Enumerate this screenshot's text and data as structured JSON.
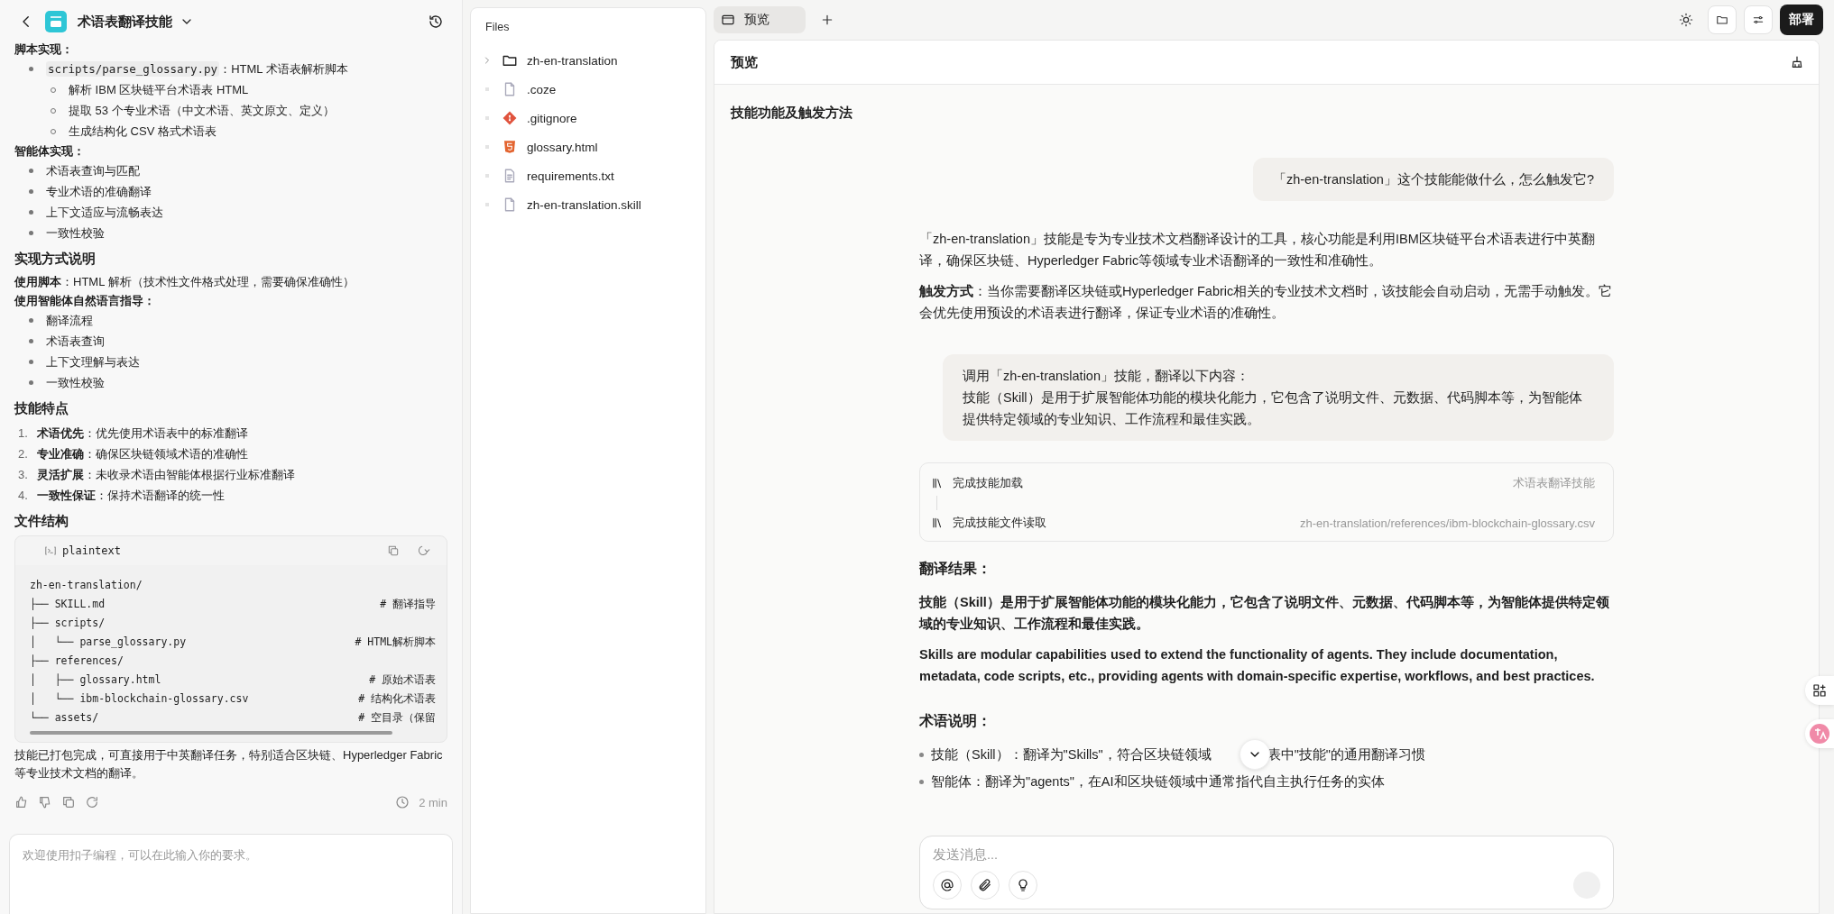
{
  "left": {
    "title": "术语表翻译技能",
    "blocks": [
      {
        "kind": "label",
        "text": "脚本实现："
      },
      {
        "kind": "bullets",
        "items": [
          {
            "code": "scripts/parse_glossary.py",
            "text": "：HTML 术语表解析脚本",
            "children": [
              {
                "text": "解析 IBM 区块链平台术语表 HTML"
              },
              {
                "text": "提取 53 个专业术语（中文术语、英文原文、定义）"
              },
              {
                "text": "生成结构化 CSV 格式术语表"
              }
            ]
          }
        ]
      },
      {
        "kind": "label",
        "text": "智能体实现："
      },
      {
        "kind": "bullets",
        "items": [
          {
            "text": "术语表查询与匹配"
          },
          {
            "text": "专业术语的准确翻译"
          },
          {
            "text": "上下文适应与流畅表达"
          },
          {
            "text": "一致性校验"
          }
        ]
      },
      {
        "kind": "heading",
        "text": "实现方式说明"
      },
      {
        "kind": "para",
        "text": "**使用脚本**：HTML 解析（技术性文件格式处理，需要确保准确性）"
      },
      {
        "kind": "label",
        "text": "使用智能体自然语言指导："
      },
      {
        "kind": "bullets",
        "items": [
          {
            "text": "翻译流程"
          },
          {
            "text": "术语表查询"
          },
          {
            "text": "上下文理解与表达"
          },
          {
            "text": "一致性校验"
          }
        ]
      },
      {
        "kind": "heading",
        "text": "技能特点"
      },
      {
        "kind": "numbered",
        "items": [
          {
            "num": "1.",
            "text": "**术语优先**：优先使用术语表中的标准翻译"
          },
          {
            "num": "2.",
            "text": "**专业准确**：确保区块链领域术语的准确性"
          },
          {
            "num": "3.",
            "text": "**灵活扩展**：未收录术语由智能体根据行业标准翻译"
          },
          {
            "num": "4.",
            "text": "**一致性保证**：保持术语翻译的统一性"
          }
        ]
      },
      {
        "kind": "heading",
        "text": "文件结构"
      },
      {
        "kind": "code",
        "lang": "plaintext",
        "lines": [
          {
            "path": "zh-en-translation/"
          },
          {
            "path": "├── SKILL.md",
            "comment": "# 翻译指导"
          },
          {
            "path": "├── scripts/"
          },
          {
            "path": "│   └── parse_glossary.py",
            "comment": "# HTML解析脚本"
          },
          {
            "path": "├── references/"
          },
          {
            "path": "│   ├── glossary.html",
            "comment": "# 原始术语表"
          },
          {
            "path": "│   └── ibm-blockchain-glossary.csv",
            "comment": "# 结构化术语表"
          },
          {
            "path": "└── assets/",
            "comment": "# 空目录（保留"
          }
        ]
      },
      {
        "kind": "para",
        "text": "技能已打包完成，可直接用于中英翻译任务，特别适合区块链、Hyperledger Fabric 等专业技术文档的翻译。"
      }
    ],
    "time": "2 min",
    "input": {
      "placeholder": "欢迎使用扣子编程，可以在此输入你的要求。"
    }
  },
  "files": {
    "title": "Files",
    "items": [
      {
        "kind": "folder",
        "name": "zh-en-translation",
        "expanded": false
      },
      {
        "kind": "file",
        "name": ".coze"
      },
      {
        "kind": "git",
        "name": ".gitignore"
      },
      {
        "kind": "html",
        "name": "glossary.html"
      },
      {
        "kind": "text",
        "name": "requirements.txt"
      },
      {
        "kind": "file",
        "name": "zh-en-translation.skill"
      }
    ]
  },
  "tabs": [
    {
      "label": "预览",
      "selected": true
    }
  ],
  "deploy": "部署",
  "preview": {
    "title": "预览",
    "section": "技能功能及触发方法",
    "messages": [
      {
        "kind": "user",
        "lines": [
          "「zh-en-translation」这个技能能做什么，怎么触发它?"
        ]
      },
      {
        "kind": "assistant",
        "blocks": [
          {
            "kind": "para",
            "text": "「zh-en-translation」技能是专为专业技术文档翻译设计的工具，核心功能是利用IBM区块链平台术语表进行中英翻译，确保区块链、Hyperledger Fabric等领域专业术语翻译的一致性和准确性。"
          },
          {
            "kind": "para",
            "text": "**触发方式**：当你需要翻译区块链或Hyperledger Fabric相关的专业技术文档时，该技能会自动启动，无需手动触发。它会优先使用预设的术语表进行翻译，保证专业术语的准确性。"
          }
        ]
      },
      {
        "kind": "user",
        "lines": [
          "调用「zh-en-translation」技能，翻译以下内容：",
          "技能（Skill）是用于扩展智能体功能的模块化能力，它包含了说明文件、元数据、代码脚本等，为智能体提供特定领域的专业知识、工作流程和最佳实践。"
        ]
      },
      {
        "kind": "tools",
        "steps": [
          {
            "label": "完成技能加载",
            "detail": "术语表翻译技能"
          },
          {
            "label": "完成技能文件读取",
            "detail": "zh-en-translation/references/ibm-blockchain-glossary.csv"
          }
        ]
      },
      {
        "kind": "assistant",
        "blocks": [
          {
            "kind": "heading",
            "text": "翻译结果："
          },
          {
            "kind": "strong",
            "text": "技能（Skill）是用于扩展智能体功能的模块化能力，它包含了说明文件、元数据、代码脚本等，为智能体提供特定领域的专业知识、工作流程和最佳实践。"
          },
          {
            "kind": "strong",
            "text": "Skills are modular capabilities used to extend the functionality of agents. They include documentation, metadata, code scripts, etc., providing agents with domain-specific expertise, workflows, and best practices."
          },
          {
            "kind": "heading",
            "text": "术语说明："
          },
          {
            "kind": "bullets",
            "items": [
              {
                "text": "技能（Skill）：翻译为\"Skills\"，符合区块链领域",
                "after": "表中\"技能\"的通用翻译习惯"
              },
              {
                "text": "智能体：翻译为\"agents\"，在AI和区块链领域中通常指代自主执行任务的实体"
              }
            ]
          }
        ]
      }
    ],
    "input": {
      "placeholder": "发送消息..."
    }
  }
}
